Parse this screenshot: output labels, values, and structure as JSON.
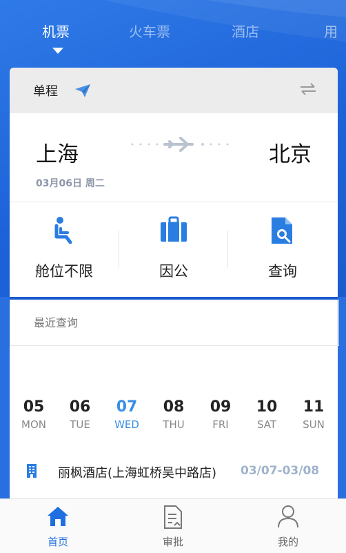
{
  "top_tabs": [
    {
      "label": "机票",
      "active": true
    },
    {
      "label": "火车票",
      "active": false
    },
    {
      "label": "酒店",
      "active": false
    },
    {
      "label": "用",
      "active": false
    }
  ],
  "search_card": {
    "trip_type": "单程",
    "from_city": "上海",
    "to_city": "北京",
    "date": "03月06日 周二",
    "options": [
      {
        "label": "舱位不限",
        "icon": "seat-icon"
      },
      {
        "label": "因公",
        "icon": "briefcase-icon"
      },
      {
        "label": "查询",
        "icon": "search-document-icon"
      }
    ]
  },
  "recent": {
    "label": "最近查询"
  },
  "week": [
    {
      "num": "05",
      "day": "MON",
      "selected": false
    },
    {
      "num": "06",
      "day": "TUE",
      "selected": false
    },
    {
      "num": "07",
      "day": "WED",
      "selected": true
    },
    {
      "num": "08",
      "day": "THU",
      "selected": false
    },
    {
      "num": "09",
      "day": "FRI",
      "selected": false
    },
    {
      "num": "10",
      "day": "SAT",
      "selected": false
    },
    {
      "num": "11",
      "day": "SUN",
      "selected": false
    }
  ],
  "hotel_item": {
    "name": "丽枫酒店(上海虹桥吴中路店)",
    "dates": "03/07-03/08",
    "icon": "building-icon"
  },
  "bottom_nav": [
    {
      "label": "首页",
      "icon": "home-icon",
      "active": true
    },
    {
      "label": "审批",
      "icon": "approval-document-icon",
      "active": false
    },
    {
      "label": "我的",
      "icon": "user-icon",
      "active": false
    }
  ],
  "colors": {
    "brand_blue": "#1d63d8",
    "selected_day": "#3a8ee6",
    "hotel_dates": "#9fb3cc"
  }
}
